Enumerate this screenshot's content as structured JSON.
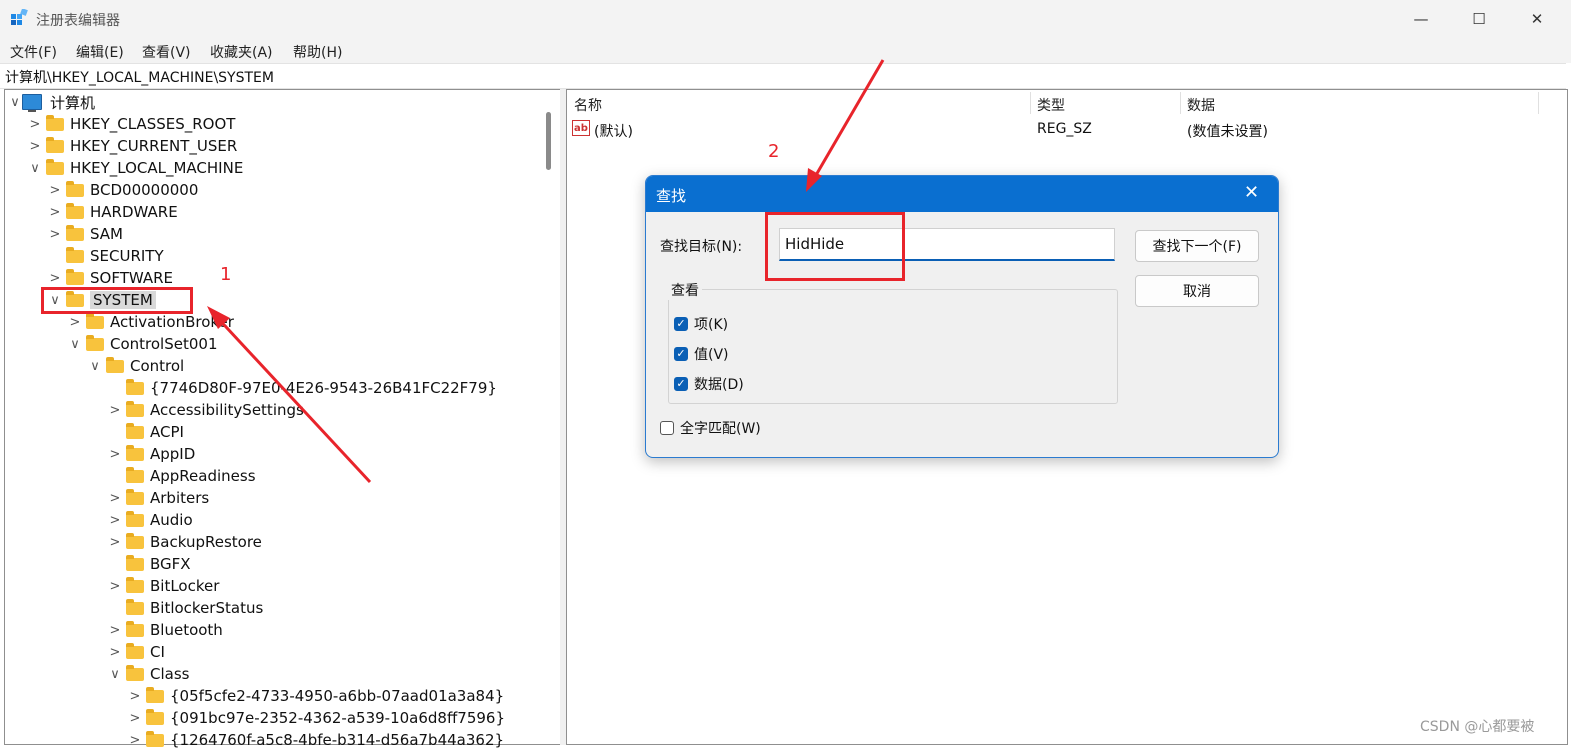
{
  "window": {
    "title": "注册表编辑器",
    "controls": {
      "minimize": "—",
      "maximize": "☐",
      "close": "✕"
    }
  },
  "menu": [
    "文件(F)",
    "编辑(E)",
    "查看(V)",
    "收藏夹(A)",
    "帮助(H)"
  ],
  "address": "计算机\\HKEY_LOCAL_MACHINE\\SYSTEM",
  "tree": [
    {
      "label": "计算机",
      "expander": "∨",
      "icon": "computer-icon"
    },
    {
      "label": "HKEY_CLASSES_ROOT",
      "expander": ">"
    },
    {
      "label": "HKEY_CURRENT_USER",
      "expander": ">"
    },
    {
      "label": "HKEY_LOCAL_MACHINE",
      "expander": "∨"
    },
    {
      "label": "BCD00000000",
      "expander": ">"
    },
    {
      "label": "HARDWARE",
      "expander": ">"
    },
    {
      "label": "SAM",
      "expander": ">"
    },
    {
      "label": "SECURITY",
      "expander": ""
    },
    {
      "label": "SOFTWARE",
      "expander": ">"
    },
    {
      "label": "SYSTEM",
      "expander": "∨",
      "selected": true
    },
    {
      "label": "ActivationBroker",
      "expander": ">"
    },
    {
      "label": "ControlSet001",
      "expander": "∨"
    },
    {
      "label": "Control",
      "expander": "∨"
    },
    {
      "label": "{7746D80F-97E0-4E26-9543-26B41FC22F79}",
      "expander": ""
    },
    {
      "label": "AccessibilitySettings",
      "expander": ">"
    },
    {
      "label": "ACPI",
      "expander": ""
    },
    {
      "label": "AppID",
      "expander": ">"
    },
    {
      "label": "AppReadiness",
      "expander": ""
    },
    {
      "label": "Arbiters",
      "expander": ">"
    },
    {
      "label": "Audio",
      "expander": ">"
    },
    {
      "label": "BackupRestore",
      "expander": ">"
    },
    {
      "label": "BGFX",
      "expander": ""
    },
    {
      "label": "BitLocker",
      "expander": ">"
    },
    {
      "label": "BitlockerStatus",
      "expander": ""
    },
    {
      "label": "Bluetooth",
      "expander": ">"
    },
    {
      "label": "CI",
      "expander": ">"
    },
    {
      "label": "Class",
      "expander": "∨"
    },
    {
      "label": "{05f5cfe2-4733-4950-a6bb-07aad01a3a84}",
      "expander": ">"
    },
    {
      "label": "{091bc97e-2352-4362-a539-10a6d8ff7596}",
      "expander": ">"
    },
    {
      "label": "{1264760f-a5c8-4bfe-b314-d56a7b44a362}",
      "expander": ">"
    }
  ],
  "list": {
    "columns": [
      "名称",
      "类型",
      "数据"
    ],
    "rows": [
      {
        "name": "(默认)",
        "type": "REG_SZ",
        "data": "(数值未设置)",
        "icon": "ab"
      }
    ]
  },
  "find_dialog": {
    "title": "查找",
    "close": "✕",
    "target_label": "查找目标(N):",
    "target_value": "HidHide",
    "find_next": "查找下一个(F)",
    "cancel": "取消",
    "look_at": "查看",
    "options": [
      {
        "label": "项(K)",
        "checked": true
      },
      {
        "label": "值(V)",
        "checked": true
      },
      {
        "label": "数据(D)",
        "checked": true
      }
    ],
    "whole_word": {
      "label": "全字匹配(W)",
      "checked": false
    }
  },
  "annotations": {
    "step1": "1",
    "step2": "2"
  },
  "watermark": "CSDN @心都要被",
  "colors": {
    "accent": "#0a6fd0",
    "annotation": "#e8242b",
    "folder": "#f8c33d"
  }
}
